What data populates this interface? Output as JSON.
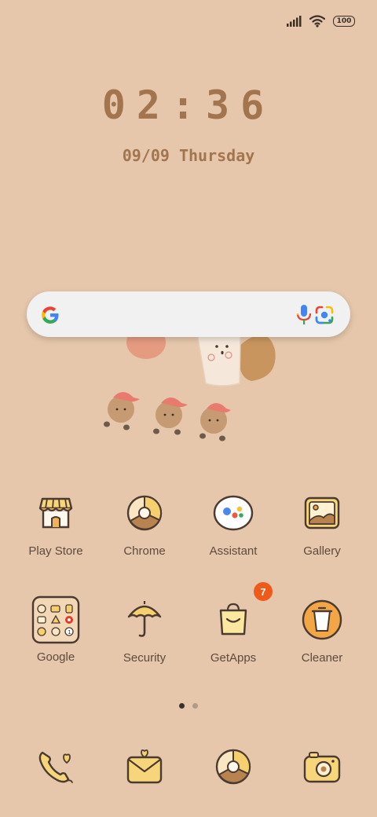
{
  "status_bar": {
    "signal_icon": "signal-icon",
    "wifi_icon": "wifi-icon",
    "battery_level": "100"
  },
  "lockscreen": {
    "time": "02:36",
    "date": "09/09 Thursday"
  },
  "search_widget": {
    "google_icon": "google-g-icon",
    "mic_icon": "mic-icon",
    "lens_icon": "google-lens-icon"
  },
  "apps": [
    {
      "label": "Play Store",
      "icon": "play-store-icon"
    },
    {
      "label": "Chrome",
      "icon": "chrome-icon"
    },
    {
      "label": "Assistant",
      "icon": "assistant-icon"
    },
    {
      "label": "Gallery",
      "icon": "gallery-icon"
    },
    {
      "label": "Google",
      "icon": "google-folder-icon"
    },
    {
      "label": "Security",
      "icon": "security-icon"
    },
    {
      "label": "GetApps",
      "icon": "getapps-icon",
      "badge": "7"
    },
    {
      "label": "Cleaner",
      "icon": "cleaner-icon"
    }
  ],
  "pager": {
    "pages": 2,
    "current": 1
  },
  "dock": [
    {
      "icon": "phone-icon"
    },
    {
      "icon": "messages-icon"
    },
    {
      "icon": "chrome-dock-icon"
    },
    {
      "icon": "camera-icon"
    }
  ],
  "colors": {
    "background": "#e6c7ab",
    "clock": "#a3754f",
    "badge": "#ef5a1a"
  }
}
